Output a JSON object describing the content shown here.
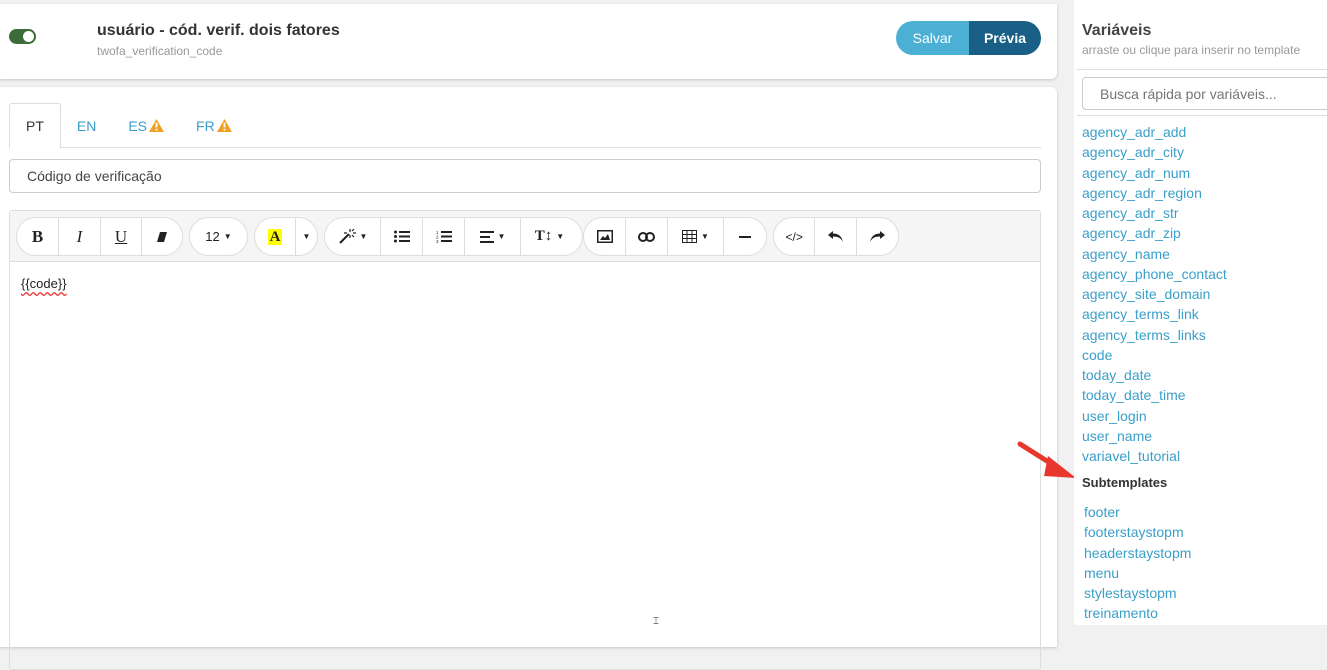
{
  "template": {
    "title": "usuário - cód. verif. dois fatores",
    "code": "twofa_verification_code",
    "enabled": true
  },
  "buttons": {
    "save": "Salvar",
    "preview": "Prévia"
  },
  "tabs": [
    {
      "label": "PT",
      "active": true,
      "warning": false
    },
    {
      "label": "EN",
      "active": false,
      "warning": false
    },
    {
      "label": "ES",
      "active": false,
      "warning": true
    },
    {
      "label": "FR",
      "active": false,
      "warning": true
    }
  ],
  "subject": "Código de verificação",
  "toolbar": {
    "font_size": "12",
    "heading_icon": "T↕"
  },
  "editor": {
    "content": "{{code}}"
  },
  "sidebar": {
    "title": "Variáveis",
    "subtitle": "arraste ou clique para inserir no template",
    "search_placeholder": "Busca rápida por variáveis...",
    "variables": [
      "agency_adr_add",
      "agency_adr_city",
      "agency_adr_num",
      "agency_adr_region",
      "agency_adr_str",
      "agency_adr_zip",
      "agency_name",
      "agency_phone_contact",
      "agency_site_domain",
      "agency_terms_link",
      "agency_terms_links",
      "code",
      "today_date",
      "today_date_time",
      "user_login",
      "user_name",
      "variavel_tutorial"
    ],
    "subtemplates_title": "Subtemplates",
    "subtemplates": [
      "footer",
      "footerstaystopm",
      "headerstaystopm",
      "menu",
      "stylestaystopm",
      "treinamento"
    ]
  },
  "colors": {
    "accent": "#3a9fc9",
    "save": "#4bb0d3",
    "preview": "#1a5f85",
    "toggle": "#3e6b3a",
    "warning": "#f0a020",
    "arrow": "#e8382e"
  }
}
